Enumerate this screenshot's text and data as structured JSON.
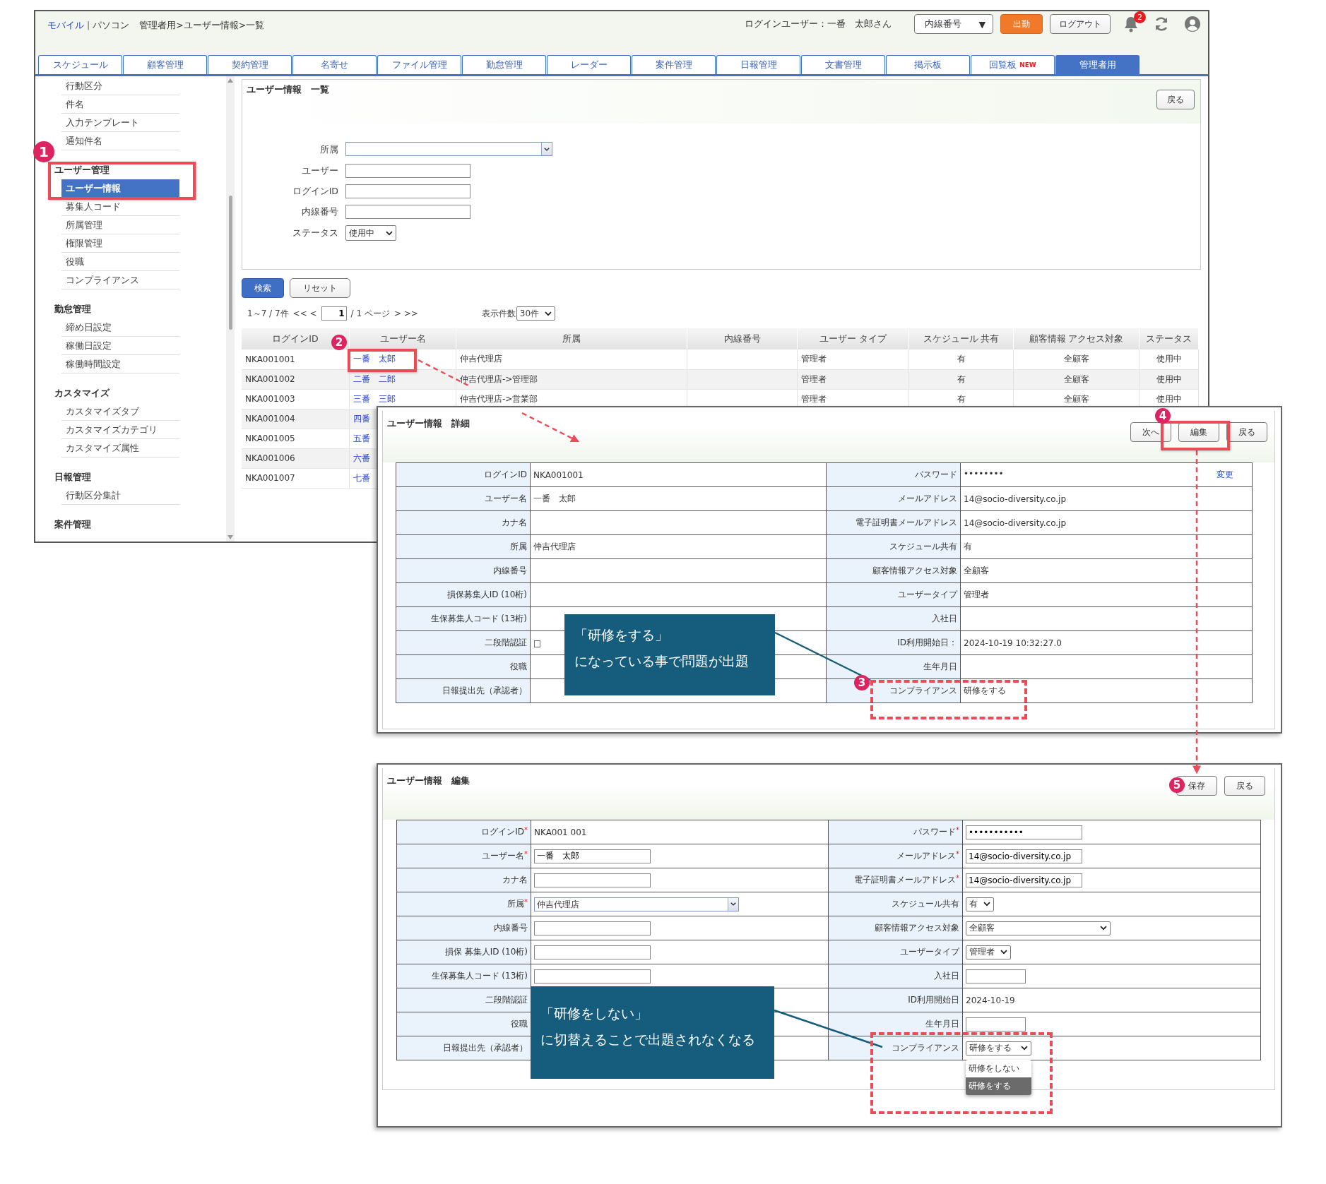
{
  "list_window": {
    "breadcrumb": [
      {
        "text": "モバイル",
        "kind": "link"
      },
      {
        "text": "|",
        "kind": "separator"
      },
      {
        "text": "パソコン",
        "kind": "text"
      },
      {
        "text": "管理者用>ユーザー情報>一覧",
        "kind": "text"
      }
    ],
    "login_user": "ログインユーザー：一番　太郎さん",
    "extension_select": {
      "value": "内線番号",
      "caret": "▼"
    },
    "clock_in_button": "出勤",
    "logout_button": "ログアウト",
    "notification_count": "2",
    "tabs": [
      {
        "label": "スケジュール",
        "selected": false
      },
      {
        "label": "顧客管理",
        "selected": false
      },
      {
        "label": "契約管理",
        "selected": false
      },
      {
        "label": "名寄せ",
        "selected": false
      },
      {
        "label": "ファイル管理",
        "selected": false
      },
      {
        "label": "勤怠管理",
        "selected": false
      },
      {
        "label": "レーダー",
        "selected": false
      },
      {
        "label": "案件管理",
        "selected": false
      },
      {
        "label": "日報管理",
        "selected": false
      },
      {
        "label": "文書管理",
        "selected": false
      },
      {
        "label": "掲示板",
        "selected": false
      },
      {
        "label": "回覧板",
        "badge": "NEW",
        "selected": false
      },
      {
        "label": "管理者用",
        "selected": true
      }
    ],
    "sidebar": [
      {
        "items": [
          {
            "label": "行動区分",
            "selected": false
          },
          {
            "label": "件名",
            "selected": false
          },
          {
            "label": "入力テンプレート",
            "selected": false
          },
          {
            "label": "通知件名",
            "selected": false
          }
        ]
      },
      {
        "heading": "ユーザー管理",
        "items": [
          {
            "label": "ユーザー情報",
            "selected": true
          },
          {
            "label": "募集人コード",
            "selected": false
          },
          {
            "label": "所属管理",
            "selected": false
          },
          {
            "label": "権限管理",
            "selected": false
          },
          {
            "label": "役職",
            "selected": false
          },
          {
            "label": "コンプライアンス",
            "selected": false
          }
        ]
      },
      {
        "heading": "勤怠管理",
        "items": [
          {
            "label": "締め日設定",
            "selected": false
          },
          {
            "label": "稼働日設定",
            "selected": false
          },
          {
            "label": "稼働時間設定",
            "selected": false
          }
        ]
      },
      {
        "heading": "カスタマイズ",
        "items": [
          {
            "label": "カスタマイズタブ",
            "selected": false
          },
          {
            "label": "カスタマイズカテゴリ",
            "selected": false
          },
          {
            "label": "カスタマイズ属性",
            "selected": false
          }
        ]
      },
      {
        "heading": "日報管理",
        "items": [
          {
            "label": "行動区分集計",
            "selected": false
          }
        ]
      },
      {
        "heading": "案件管理"
      }
    ],
    "search_panel": {
      "title": "ユーザー情報　一覧",
      "back_button": "戻る",
      "fields": [
        {
          "label": "所属",
          "kind": "combo"
        },
        {
          "label": "ユーザー",
          "kind": "text"
        },
        {
          "label": "ログインID",
          "kind": "text"
        },
        {
          "label": "内線番号",
          "kind": "text"
        },
        {
          "label": "ステータス",
          "kind": "select",
          "value": "使用中"
        }
      ]
    },
    "search_button": "検索",
    "reset_button": "リセット",
    "pagination": {
      "range": "1～7 / 7件",
      "first_prev": "<< <",
      "page": "1",
      "pages": "/ 1 ページ",
      "next_last": "> >>"
    },
    "page_size": {
      "label": "表示件数",
      "value": "30件"
    },
    "table": {
      "columns": [
        {
          "label": "ログインID"
        },
        {
          "label": "ユーザー名",
          "link": true
        },
        {
          "label": "所属"
        },
        {
          "label": "内線番号"
        },
        {
          "label": "ユーザー タイプ"
        },
        {
          "label": "スケジュール 共有"
        },
        {
          "label": "顧客情報 アクセス対象"
        },
        {
          "label": "ステータス"
        }
      ],
      "rows": [
        [
          "NKA001001",
          "一番　太郎",
          "仲吉代理店",
          "",
          "管理者",
          "有",
          "全顧客",
          "使用中"
        ],
        [
          "NKA001002",
          "二番　二郎",
          "仲吉代理店->管理部",
          "",
          "管理者",
          "有",
          "全顧客",
          "使用中"
        ],
        [
          "NKA001003",
          "三番　三郎",
          "仲吉代理店->営業部",
          "",
          "管理者",
          "有",
          "全顧客",
          "使用中"
        ],
        [
          "NKA001004",
          "四番"
        ],
        [
          "NKA001005",
          "五番"
        ],
        [
          "NKA001006",
          "六番"
        ],
        [
          "NKA001007",
          "七番"
        ]
      ]
    }
  },
  "detail_window": {
    "title": "ユーザー情報　詳細",
    "buttons": [
      "次へ",
      "編集",
      "戻る"
    ],
    "rows": [
      {
        "left": {
          "label": "ログインID",
          "value": "NKA001001"
        },
        "right": {
          "label": "パスワード",
          "value": "••••••••",
          "action": "変更"
        }
      },
      {
        "left": {
          "label": "ユーザー名",
          "value": "一番　太郎"
        },
        "right": {
          "label": "メールアドレス",
          "value": "14@socio-diversity.co.jp"
        }
      },
      {
        "left": {
          "label": "カナ名"
        },
        "right": {
          "label": "電子証明書メールアドレス",
          "value": "14@socio-diversity.co.jp"
        }
      },
      {
        "left": {
          "label": "所属",
          "value": "仲吉代理店"
        },
        "right": {
          "label": "スケジュール共有",
          "value": "有"
        }
      },
      {
        "left": {
          "label": "内線番号"
        },
        "right": {
          "label": "顧客情報アクセス対象",
          "value": "全顧客"
        }
      },
      {
        "left": {
          "label": "損保募集人ID (10桁)"
        },
        "right": {
          "label": "ユーザータイプ",
          "value": "管理者"
        }
      },
      {
        "left": {
          "label": "生保募集人コード (13桁)"
        },
        "right": {
          "label": "入社日"
        }
      },
      {
        "left": {
          "label": "二段階認証",
          "value": "□"
        },
        "right": {
          "label": "ID利用開始日：",
          "value": "2024-10-19 10:32:27.0"
        }
      },
      {
        "left": {
          "label": "役職"
        },
        "right": {
          "label": "生年月日"
        }
      },
      {
        "left": {
          "label": "日報提出先（承認者）"
        },
        "right": {
          "label": "コンプライアンス",
          "value": "研修をする"
        }
      }
    ]
  },
  "edit_window": {
    "title": "ユーザー情報　編集",
    "buttons": [
      "保存",
      "戻る"
    ],
    "rows": [
      {
        "left": {
          "label": "ログインID",
          "required": "*",
          "kind": "text",
          "value": "NKA001 001"
        },
        "right": {
          "label": "パスワード",
          "required": "*",
          "kind": "input",
          "value": "•••••••••••"
        }
      },
      {
        "left": {
          "label": "ユーザー名",
          "required": "*",
          "kind": "input",
          "value": "一番　太郎"
        },
        "right": {
          "label": "メールアドレス",
          "required": "*",
          "kind": "input",
          "value": "14@socio-diversity.co.jp"
        }
      },
      {
        "left": {
          "label": "カナ名",
          "kind": "input"
        },
        "right": {
          "label": "電子証明書メールアドレス",
          "required": "*",
          "kind": "input",
          "value": "14@socio-diversity.co.jp"
        }
      },
      {
        "left": {
          "label": "所属",
          "required": "*",
          "kind": "combo",
          "value": "仲吉代理店"
        },
        "right": {
          "label": "スケジュール共有",
          "kind": "select",
          "value": "有"
        }
      },
      {
        "left": {
          "label": "内線番号",
          "kind": "input"
        },
        "right": {
          "label": "顧客情報アクセス対象",
          "kind": "picker",
          "value": "全顧客"
        }
      },
      {
        "left": {
          "label": "損保 募集人ID (10桁)",
          "kind": "input"
        },
        "right": {
          "label": "ユーザータイプ",
          "kind": "select",
          "value": "管理者"
        }
      },
      {
        "left": {
          "label": "生保募集人コード (13桁)",
          "kind": "input"
        },
        "right": {
          "label": "入社日",
          "kind": "date"
        }
      },
      {
        "left": {
          "label": "二段階認証"
        },
        "right": {
          "label": "ID利用開始日",
          "kind": "text",
          "value": "2024-10-19"
        }
      },
      {
        "left": {
          "label": "役職"
        },
        "right": {
          "label": "生年月日",
          "kind": "date"
        }
      },
      {
        "left": {
          "label": "日報提出先（承認者）"
        },
        "right": {
          "label": "コンプライアンス",
          "kind": "select",
          "value": "研修をする",
          "options": [
            {
              "label": "研修をしない",
              "selected": false
            },
            {
              "label": "研修をする",
              "selected": true
            }
          ]
        }
      }
    ]
  },
  "annotations": {
    "markers": [
      "1",
      "2",
      "3",
      "4",
      "5"
    ],
    "callouts": [
      {
        "lines": [
          "「研修をする」",
          "になっている事で問題が出題"
        ]
      },
      {
        "lines": [
          "「研修をしない」",
          "に切替えることで出題されなくなる"
        ]
      }
    ]
  }
}
